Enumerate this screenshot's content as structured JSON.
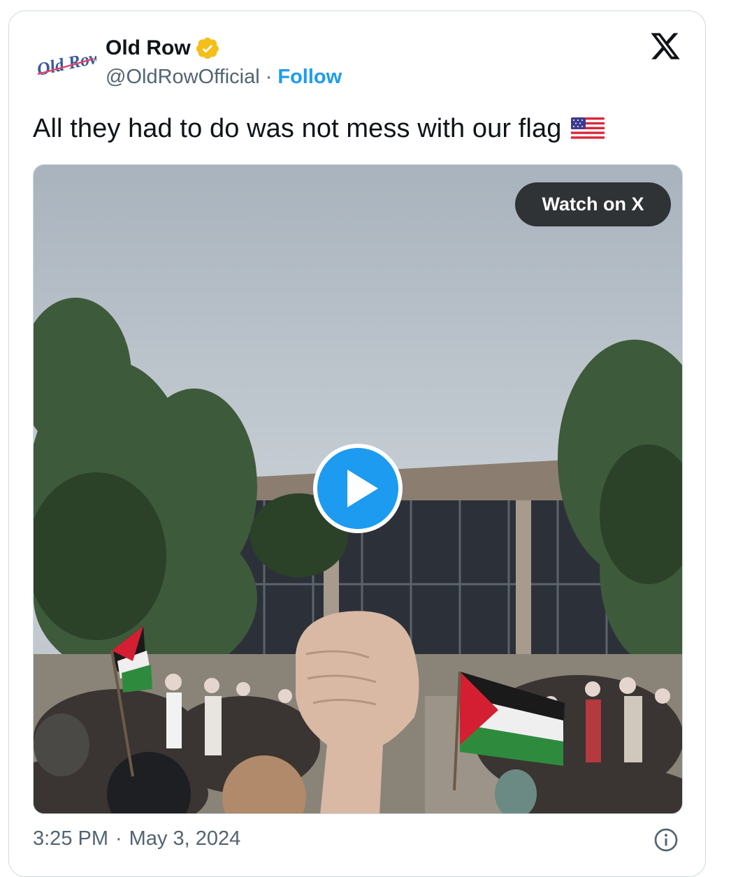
{
  "author": {
    "display_name": "Old Row",
    "handle": "@OldRowOfficial",
    "separator": "·",
    "follow_label": "Follow",
    "avatar_text": "Old Row",
    "verified_icon": "verified-badge-icon",
    "verified_color": "#f4bf1a"
  },
  "brand_icon": "x-logo-icon",
  "tweet": {
    "text": "All they had to do was not mess with our flag",
    "emoji": "us-flag-emoji"
  },
  "media": {
    "type": "video",
    "watch_label": "Watch on X",
    "play_icon": "play-button-icon",
    "play_color": "#1d9bf0"
  },
  "footer": {
    "time": "3:25 PM",
    "separator": "·",
    "date": "May 3, 2024",
    "info_icon": "info-icon"
  },
  "colors": {
    "accent": "#1d9bf0",
    "text": "#0f1419",
    "muted": "#536471",
    "border": "#cfd9de"
  }
}
